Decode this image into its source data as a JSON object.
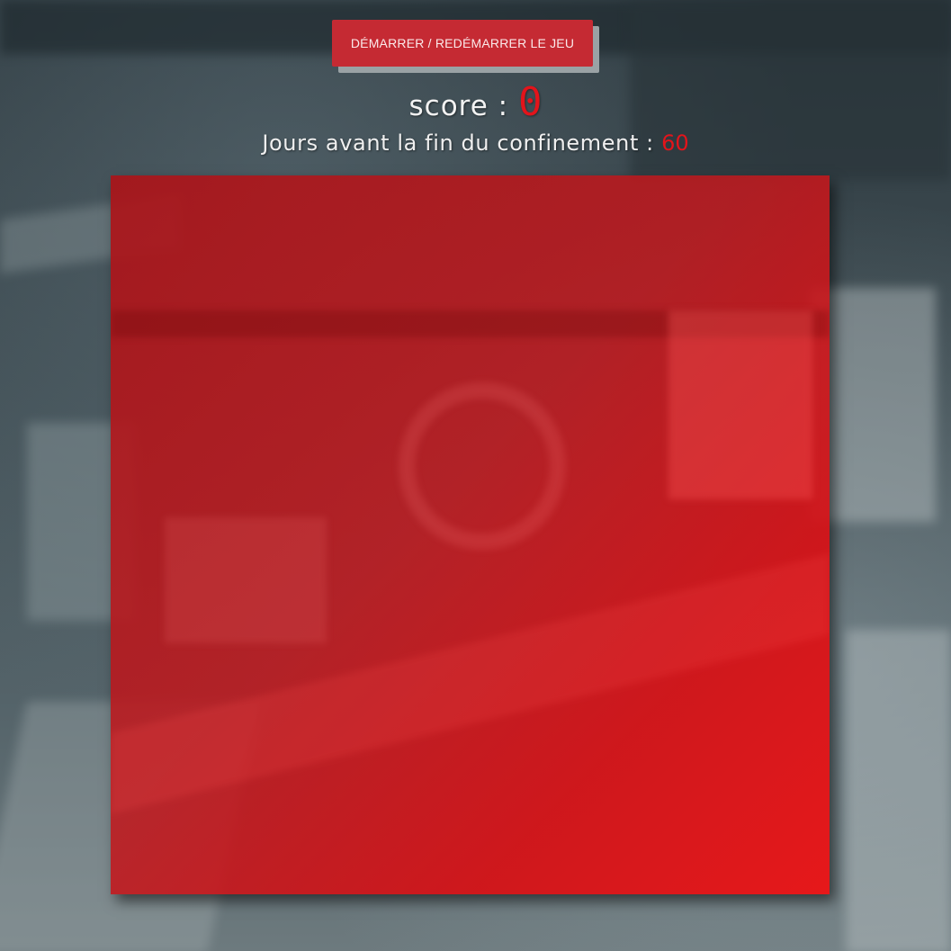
{
  "controls": {
    "start_button_label": "DÉMARRER / REDÉMARRER LE JEU"
  },
  "score": {
    "label": "score : ",
    "value": "0"
  },
  "days": {
    "label": "Jours avant la fin du confinement : ",
    "value": "60"
  },
  "colors": {
    "accent": "#e3141b",
    "button": "#c52a33",
    "board": "#d0151c"
  }
}
